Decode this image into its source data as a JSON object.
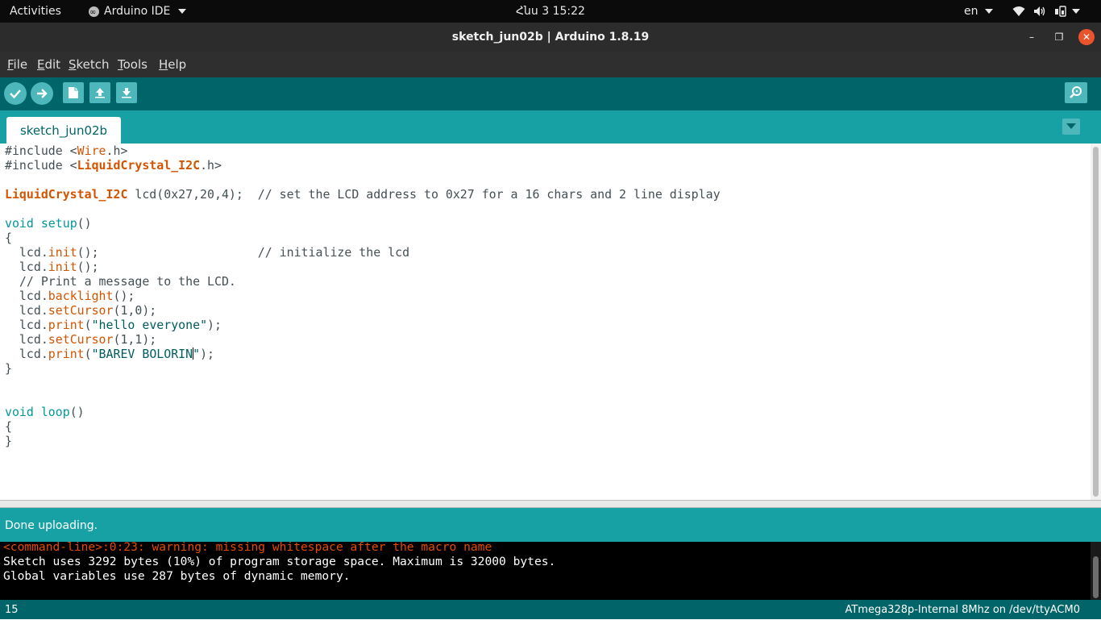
{
  "system_bar": {
    "activities": "Activities",
    "app_name": "Arduino IDE",
    "clock": "Հնս 3  15:22",
    "lang": "en"
  },
  "window": {
    "title": "sketch_jun02b | Arduino 1.8.19",
    "minimize_icon": "–",
    "maximize_icon": "❐",
    "close_icon": "✕"
  },
  "menu": {
    "file": {
      "first": "F",
      "rest": "ile"
    },
    "edit": {
      "first": "E",
      "rest": "dit"
    },
    "sketch": {
      "first": "S",
      "rest": "ketch"
    },
    "tools": {
      "first": "T",
      "rest": "ools"
    },
    "help": {
      "first": "H",
      "rest": "elp"
    }
  },
  "toolbar": {
    "buttons": [
      "verify-icon",
      "upload-icon",
      "new-icon",
      "open-icon",
      "save-icon",
      "serial-monitor-icon"
    ]
  },
  "tab": {
    "label": "sketch_jun02b"
  },
  "code": {
    "l1": {
      "a": "#include <",
      "b": "Wire",
      "c": ".h>"
    },
    "l2": {
      "a": "#include <",
      "b": "LiquidCrystal_I2C",
      "c": ".h>"
    },
    "l4": {
      "a": "LiquidCrystal_I2C",
      "b": " lcd(0x27,20,4);  ",
      "c": "// set the LCD address to 0x27 for a 16 chars and 2 line display"
    },
    "l6": {
      "a": "void",
      "b": " ",
      "c": "setup",
      "d": "()"
    },
    "l7": "{",
    "l8": {
      "a": "  lcd.",
      "b": "init",
      "c": "();                      ",
      "d": "// initialize the lcd"
    },
    "l9": {
      "a": "  lcd.",
      "b": "init",
      "c": "();"
    },
    "l10": "  // Print a message to the LCD.",
    "l11": {
      "a": "  lcd.",
      "b": "backlight",
      "c": "();"
    },
    "l12": {
      "a": "  lcd.",
      "b": "setCursor",
      "c": "(1,0);"
    },
    "l13": {
      "a": "  lcd.",
      "b": "print",
      "c": "(",
      "d": "\"hello everyone\"",
      "e": ");"
    },
    "l14": {
      "a": "  lcd.",
      "b": "setCursor",
      "c": "(1,1);"
    },
    "l15": {
      "a": "  lcd.",
      "b": "print",
      "c": "(",
      "d1": "\"BAREV BOLORIN",
      "d2": "\"",
      "e": ");"
    },
    "l16": "}",
    "l19": {
      "a": "void",
      "b": " ",
      "c": "loop",
      "d": "()"
    },
    "l20": "{",
    "l21": "}"
  },
  "status": {
    "message": "Done uploading."
  },
  "console": {
    "lines": [
      "<command-line>:0:23: warning: missing whitespace after the macro name",
      "Sketch uses 3292 bytes (10%) of program storage space. Maximum is 32000 bytes.",
      "Global variables use 287 bytes of dynamic memory."
    ]
  },
  "bottom": {
    "line_number": "15",
    "board": "ATmega328p-Internal 8Mhz on /dev/ttyACM0"
  },
  "colors": {
    "toolbar": "#006468",
    "tabstrip": "#17a1a5",
    "button": "#4db7bb",
    "keyword": "#00979c",
    "function": "#d35400",
    "console_error": "#e34c00"
  }
}
